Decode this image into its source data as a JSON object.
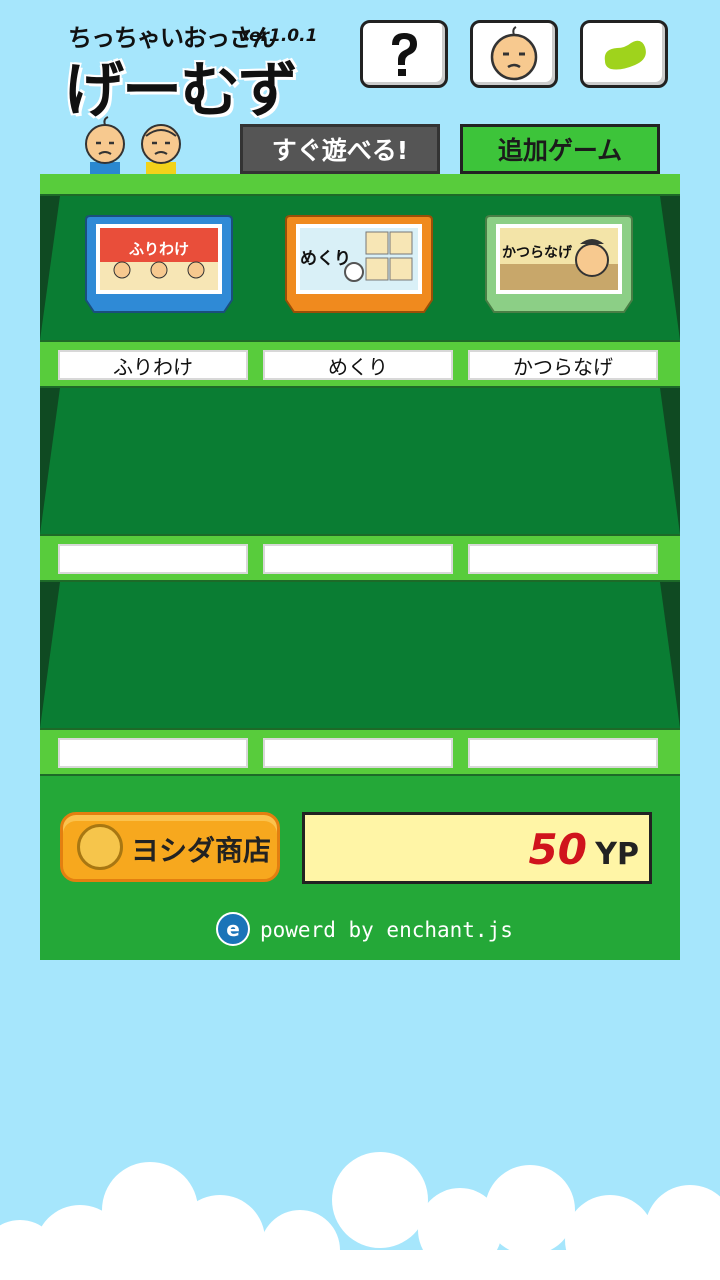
{
  "logo": {
    "subtitle": "ちっちゃいおっさん",
    "version": "ver1.0.1",
    "title": "げーむず"
  },
  "top_buttons": [
    {
      "name": "help",
      "icon": "question-mark-icon"
    },
    {
      "name": "avatar",
      "icon": "ossan-face-icon"
    },
    {
      "name": "bean",
      "icon": "bean-icon"
    }
  ],
  "tabs": [
    {
      "label": "すぐ遊べる!",
      "active": false
    },
    {
      "label": "追加ゲーム",
      "active": true
    }
  ],
  "shelves": [
    {
      "games": [
        {
          "title": "ふりわけ",
          "cart_color": "#2f8ad6",
          "cart_label": "ふりわけ"
        },
        {
          "title": "めくり",
          "cart_color": "#f08a1e",
          "cart_label": "めくり"
        },
        {
          "title": "かつらなげ",
          "cart_color": "#8ccf86",
          "cart_label": "かつらなげ"
        }
      ]
    },
    {
      "games": [
        {
          "title": ""
        },
        {
          "title": ""
        },
        {
          "title": ""
        }
      ]
    },
    {
      "games": [
        {
          "title": ""
        },
        {
          "title": ""
        },
        {
          "title": ""
        }
      ]
    }
  ],
  "shop": {
    "label": "ヨシダ商店",
    "coin_icon": "coin-face-icon"
  },
  "points": {
    "value": "50",
    "unit": "YP"
  },
  "footer": {
    "powered": "powerd by enchant.js",
    "logo_icon": "enchant-logo-icon",
    "logo_letter": "e"
  },
  "colors": {
    "sky": "#a6e6fc",
    "shelf_dark": "#1b5e2d",
    "shelf_green": "#58cc3c",
    "panel_green": "#24a838",
    "points_red": "#d0131c",
    "shop_orange": "#f7a81e"
  }
}
